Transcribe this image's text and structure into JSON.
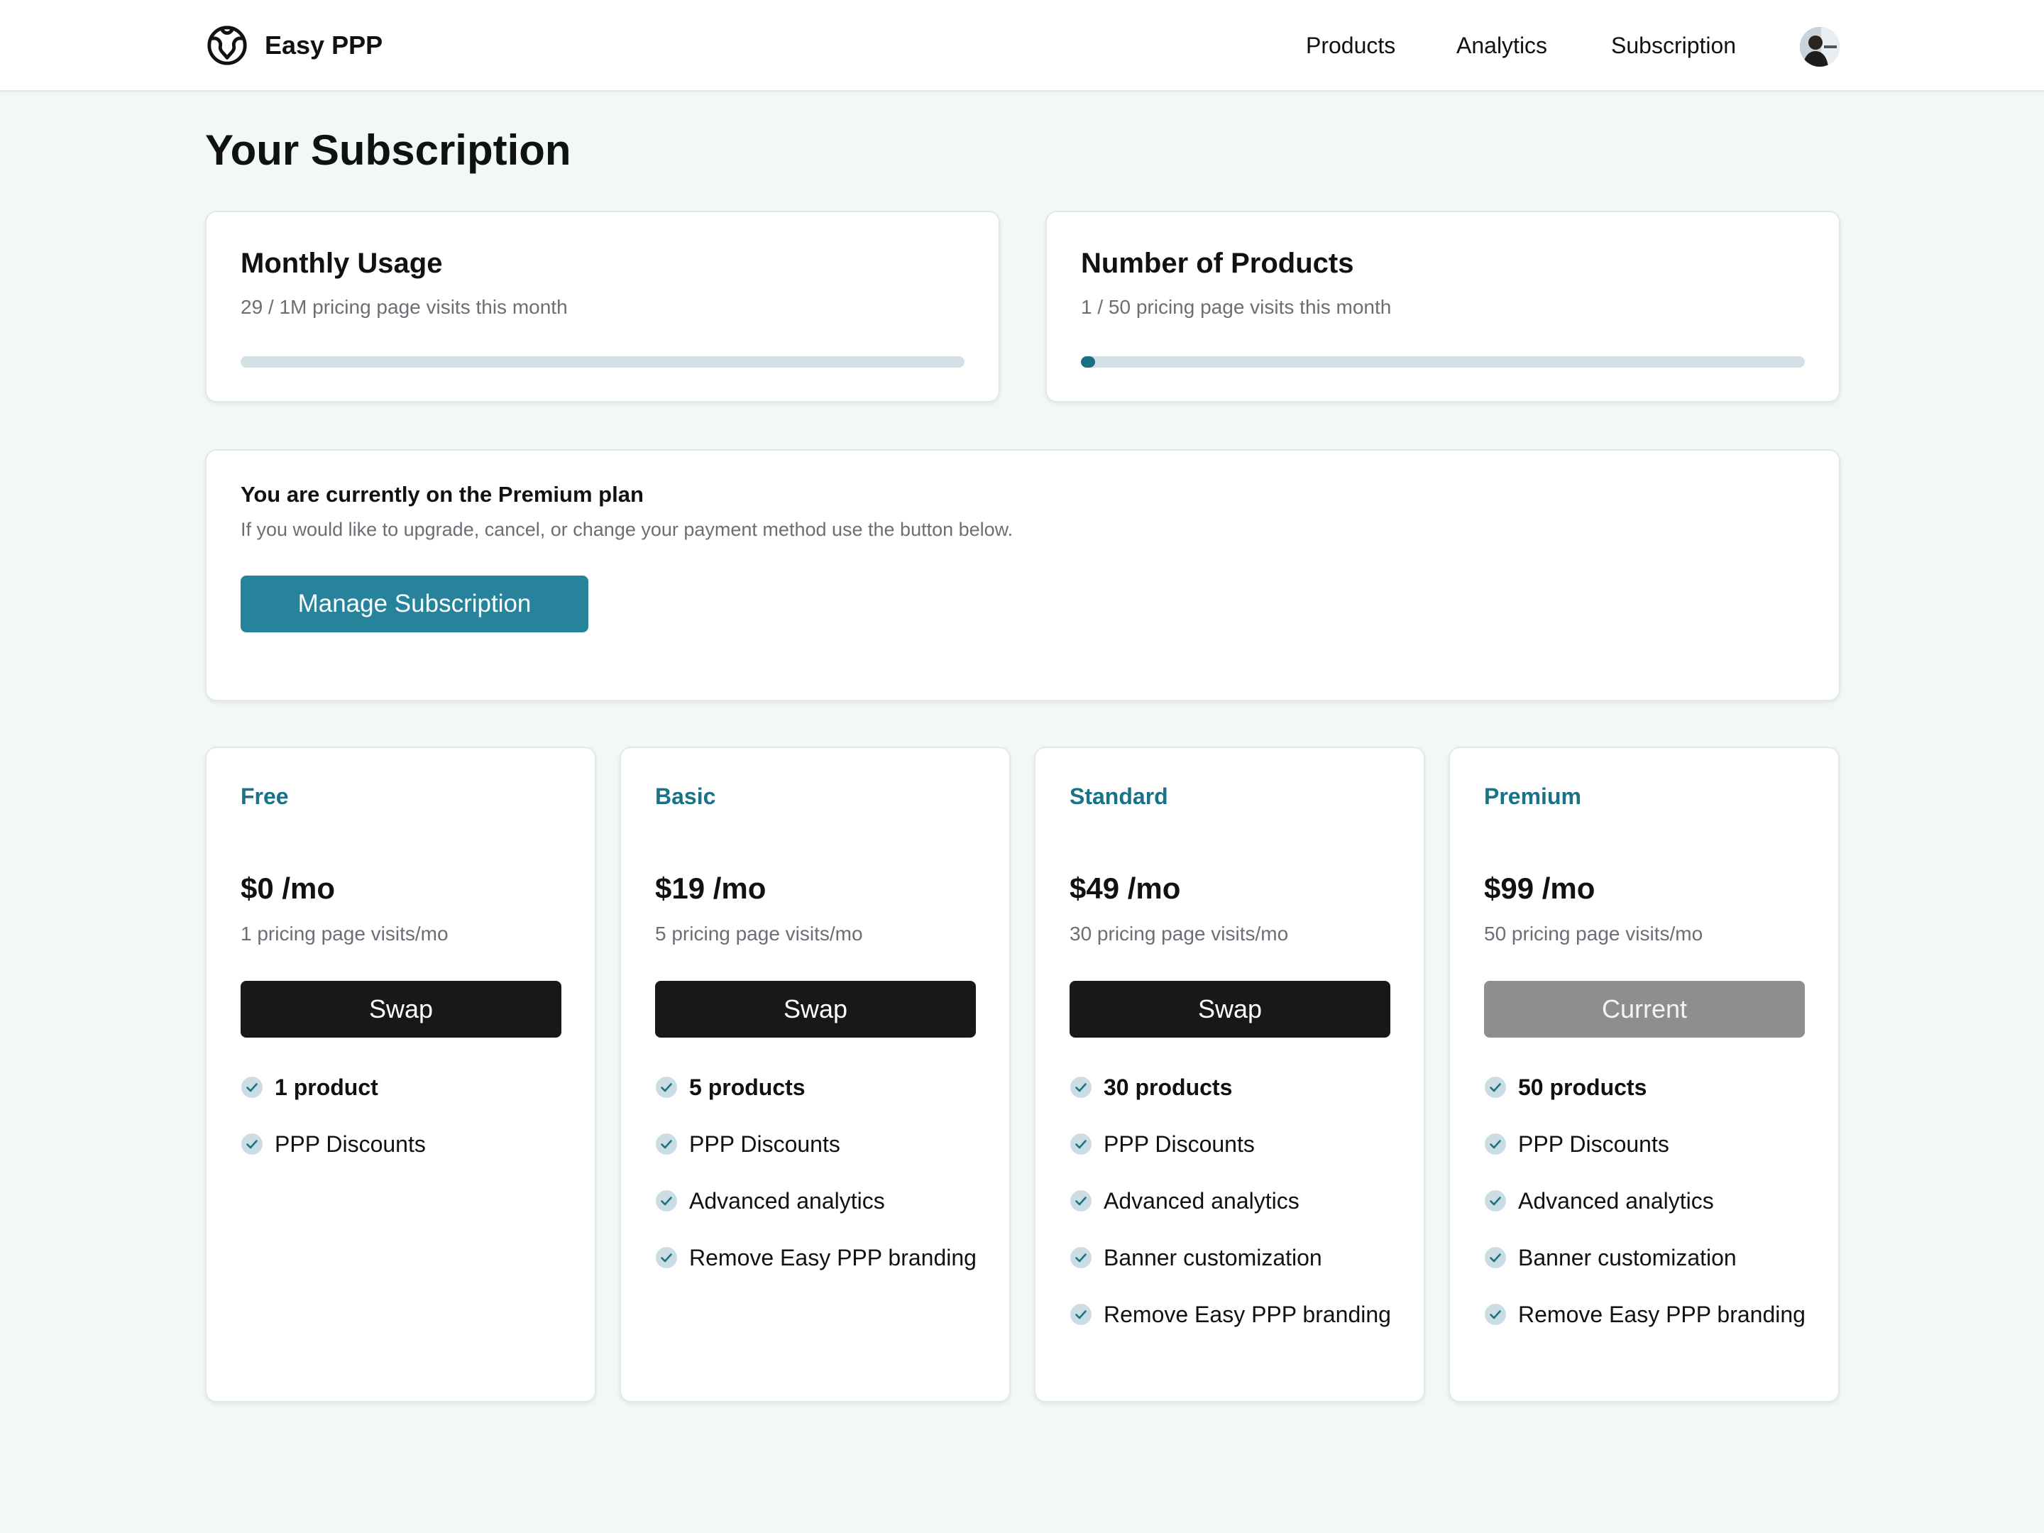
{
  "header": {
    "brand": "Easy PPP",
    "nav": [
      "Products",
      "Analytics",
      "Subscription"
    ]
  },
  "page": {
    "title": "Your Subscription"
  },
  "usage": [
    {
      "title": "Monthly Usage",
      "subtitle": "29 / 1M pricing page visits this month",
      "progress_percent": 0.003
    },
    {
      "title": "Number of Products",
      "subtitle": "1 / 50 pricing page visits this month",
      "progress_percent": 2
    }
  ],
  "plan": {
    "heading": "You are currently on the Premium plan",
    "description": "If you would like to upgrade, cancel, or change your payment method use the button below.",
    "manage_label": "Manage Subscription"
  },
  "tiers": [
    {
      "name": "Free",
      "price": "$0 /mo",
      "visits": "1 pricing page visits/mo",
      "button": "Swap",
      "current": false,
      "features": [
        "1 product",
        "PPP Discounts"
      ]
    },
    {
      "name": "Basic",
      "price": "$19 /mo",
      "visits": "5 pricing page visits/mo",
      "button": "Swap",
      "current": false,
      "features": [
        "5 products",
        "PPP Discounts",
        "Advanced analytics",
        "Remove Easy PPP branding"
      ]
    },
    {
      "name": "Standard",
      "price": "$49 /mo",
      "visits": "30 pricing page visits/mo",
      "button": "Swap",
      "current": false,
      "features": [
        "30 products",
        "PPP Discounts",
        "Advanced analytics",
        "Banner customization",
        "Remove Easy PPP branding"
      ]
    },
    {
      "name": "Premium",
      "price": "$99 /mo",
      "visits": "50 pricing page visits/mo",
      "button": "Current",
      "current": true,
      "features": [
        "50 products",
        "PPP Discounts",
        "Advanced analytics",
        "Banner customization",
        "Remove Easy PPP branding"
      ]
    }
  ],
  "colors": {
    "accent": "#27839c",
    "tier_name": "#1a7287",
    "progress_fill": "#1a6f80",
    "progress_track": "#d3e1e5",
    "page_bg": "#f2f7f7",
    "check_bg": "#c9dde3"
  },
  "icons": {
    "brand": "globe-logo-icon",
    "feature": "check-circle-icon"
  }
}
